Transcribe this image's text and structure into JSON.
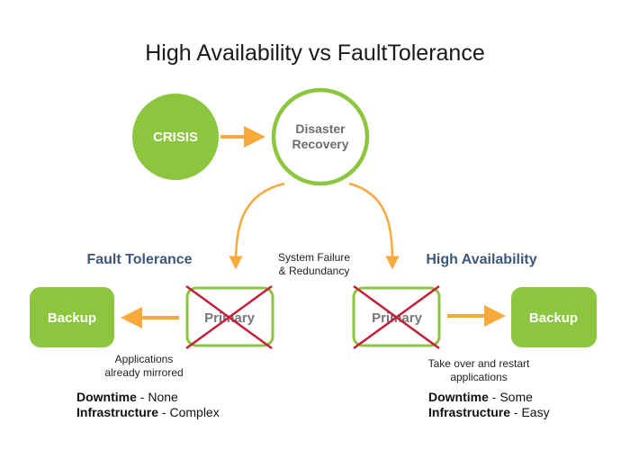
{
  "title": "High Availability vs FaultTolerance",
  "colors": {
    "green": "#8cc63f",
    "orange": "#f7a93b",
    "heading_blue": "#3b5878",
    "cross_red": "#c41e3a",
    "primary_text": "#777777"
  },
  "nodes": {
    "crisis": "CRISIS",
    "disaster_recovery": [
      "Disaster",
      "Recovery"
    ]
  },
  "center_label": [
    "System Failure",
    "& Redundancy"
  ],
  "fault_tolerance": {
    "heading": "Fault Tolerance",
    "backup": "Backup",
    "primary": "Primary",
    "note": [
      "Applications",
      "already mirrored"
    ],
    "downtime_label": "Downtime",
    "downtime_value": " - None",
    "infrastructure_label": "Infrastructure",
    "infrastructure_value": " - Complex"
  },
  "high_availability": {
    "heading": "High Availability",
    "backup": "Backup",
    "primary": "Primary",
    "note": [
      "Take over and restart",
      "applications"
    ],
    "downtime_label": "Downtime",
    "downtime_value": " - Some",
    "infrastructure_label": "Infrastructure",
    "infrastructure_value": " - Easy"
  }
}
